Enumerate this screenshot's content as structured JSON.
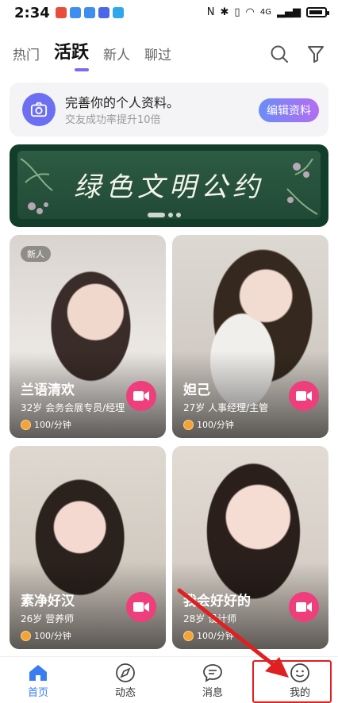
{
  "status_bar": {
    "time": "2:34",
    "network": "4G"
  },
  "tabs": [
    {
      "label": "热门"
    },
    {
      "label": "活跃"
    },
    {
      "label": "新人"
    },
    {
      "label": "聊过"
    }
  ],
  "active_tab": "活跃",
  "icons": {
    "search": "search-icon",
    "filter": "filter-icon",
    "camera": "camera-icon",
    "video": "video-call-icon"
  },
  "profile_prompt": {
    "title": "完善你的个人资料。",
    "subtitle": "交友成功率提升10倍",
    "button": "编辑资料"
  },
  "banner": {
    "text": "绿色文明公约"
  },
  "cards": [
    {
      "badge": "新人",
      "name": "兰语清欢",
      "meta": "32岁  会务会展专员/经理",
      "price": "100/分钟"
    },
    {
      "badge": "",
      "name": "妲己",
      "meta": "27岁  人事经理/主管",
      "price": "100/分钟"
    },
    {
      "badge": "",
      "name": "素净好汉",
      "meta": "26岁  营养师",
      "price": "100/分钟"
    },
    {
      "badge": "",
      "name": "我会好好的",
      "meta": "28岁  设计师",
      "price": "100/分钟"
    }
  ],
  "bottom_nav": [
    {
      "label": "首页"
    },
    {
      "label": "动态"
    },
    {
      "label": "消息"
    },
    {
      "label": "我的"
    }
  ],
  "colors": {
    "accent": "#3a7df0",
    "tab_underline": "#7a6cf0",
    "video_button": "#ee3e7c",
    "highlight": "#e02020"
  }
}
